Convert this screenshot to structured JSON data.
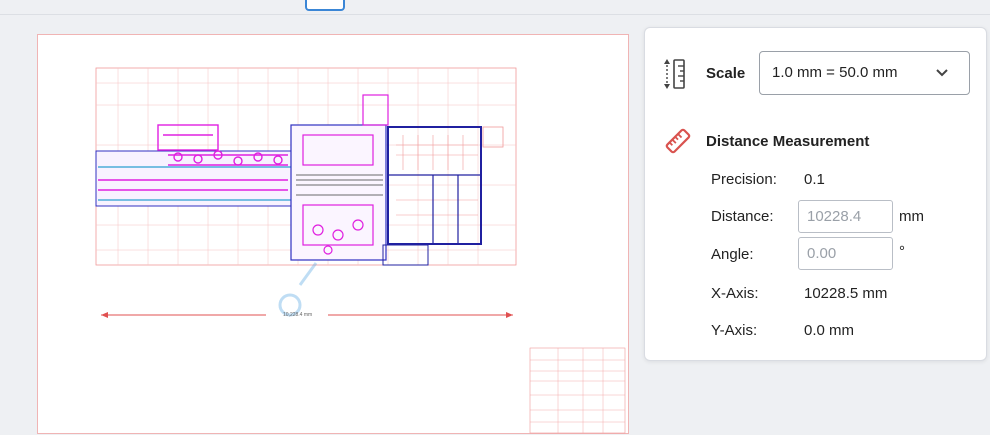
{
  "scale": {
    "label": "Scale",
    "selected": "1.0 mm = 50.0 mm"
  },
  "measurement": {
    "title": "Distance Measurement",
    "precision_label": "Precision:",
    "precision_value": "0.1",
    "distance_label": "Distance:",
    "distance_value": "10228.4",
    "distance_unit": "mm",
    "angle_label": "Angle:",
    "angle_value": "0.00",
    "angle_unit": "°",
    "xaxis_label": "X-Axis:",
    "xaxis_value": "10228.5 mm",
    "yaxis_label": "Y-Axis:",
    "yaxis_value": "0.0 mm"
  },
  "drawing": {
    "dimension_label": "10,228.4 mm"
  },
  "colors": {
    "accent": "#3a86d6",
    "ruler_icon": "#d9534f"
  }
}
